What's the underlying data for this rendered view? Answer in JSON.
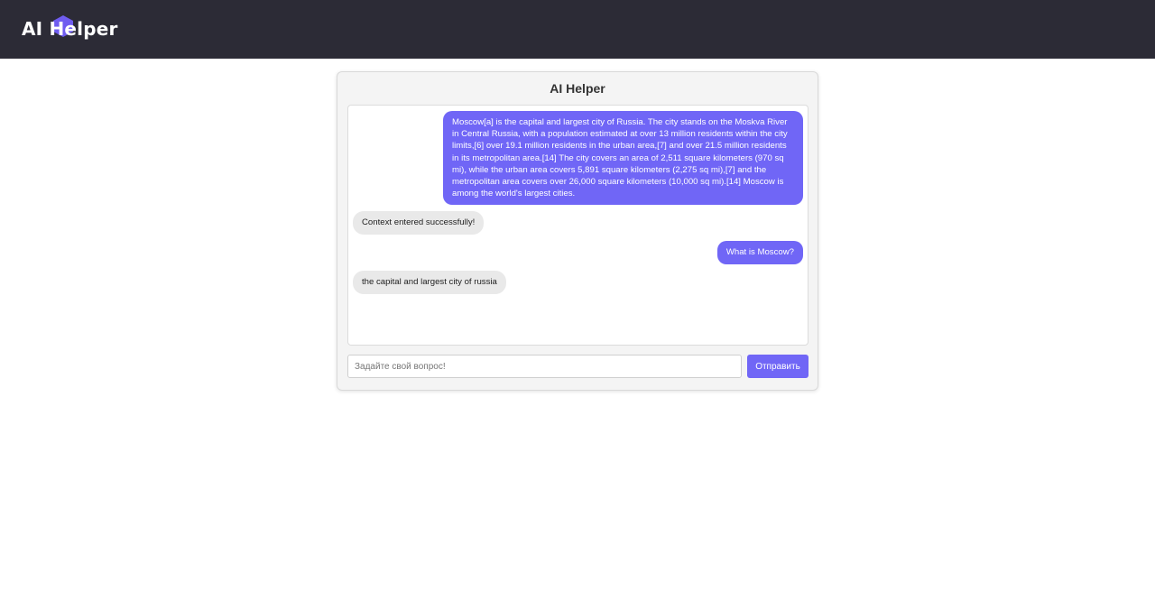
{
  "header": {
    "logo_text": "AI Helper"
  },
  "card": {
    "title": "AI Helper"
  },
  "messages": [
    {
      "role": "user",
      "text": "Moscow[a] is the capital and largest city of Russia. The city stands on the Moskva River in Central Russia, with a population estimated at over 13 million residents within the city limits,[6] over 19.1 million residents in the urban area,[7] and over 21.5 million residents in its metropolitan area.[14] The city covers an area of 2,511 square kilometers (970 sq mi), while the urban area covers 5,891 square kilometers (2,275 sq mi),[7] and the metropolitan area covers over 26,000 square kilometers (10,000 sq mi).[14] Moscow is among the world's largest cities."
    },
    {
      "role": "bot",
      "text": "Context entered successfully!"
    },
    {
      "role": "user",
      "text": "What is Moscow?"
    },
    {
      "role": "bot",
      "text": "the capital and largest city of russia"
    }
  ],
  "composer": {
    "placeholder": "Задайте свой вопрос!",
    "value": "",
    "send_label": "Отправить"
  },
  "colors": {
    "header_bg": "#2c2b36",
    "accent": "#7066f6",
    "bot_bubble": "#e9e9e9"
  }
}
